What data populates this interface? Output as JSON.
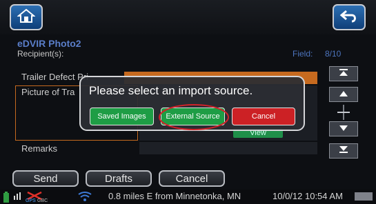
{
  "header": {
    "title": "eDVIR Photo2",
    "recipients_label": "Recipient(s):",
    "field_label": "Field:",
    "field_position": "8/10"
  },
  "form": {
    "trailer_label": "Trailer Defect Pri",
    "picture_label": "Picture of Tra",
    "remarks_label": "Remarks",
    "view_button": "View"
  },
  "modal": {
    "title": "Please select an import source.",
    "saved_images": "Saved Images",
    "external_source": "External Source",
    "cancel": "Cancel"
  },
  "footer": {
    "send": "Send",
    "drafts": "Drafts",
    "cancel": "Cancel"
  },
  "status": {
    "gps_label": "GPS",
    "gbc_label": "GBC",
    "location": "0.8 miles E from Minnetonka, MN",
    "datetime": "10/0/12 10:54 AM"
  },
  "icons": {
    "home": "home-icon",
    "back": "back-arrow-icon",
    "scroll_top": "scroll-top-icon",
    "scroll_up": "scroll-up-icon",
    "scroll_down": "scroll-down-icon",
    "scroll_bottom": "scroll-bottom-icon"
  }
}
